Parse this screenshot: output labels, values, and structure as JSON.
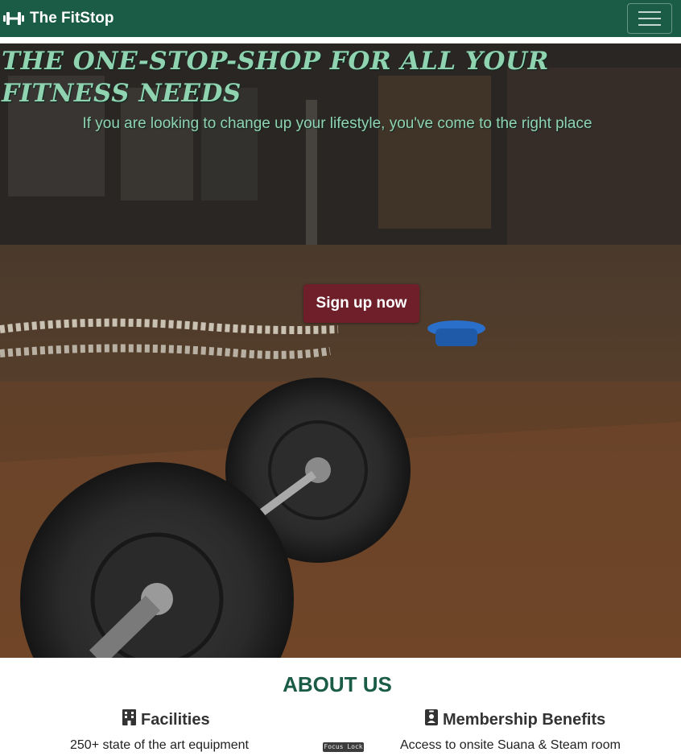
{
  "navbar": {
    "brand_icon": "dumbbell-icon",
    "brand_name": "The FitStop",
    "toggler_icon": "hamburger-icon"
  },
  "hero": {
    "title": "THE ONE-STOP-SHOP FOR ALL YOUR FITNESS NEEDS",
    "subtitle": "If you are looking to change up your lifestyle, you've come to the right place",
    "cta_label": "Sign up now",
    "background": "gym-floor-barbell-photo"
  },
  "about": {
    "title": "ABOUT US",
    "columns": [
      {
        "icon": "building-icon",
        "heading": "Facilities",
        "text": "250+ state of the art equipment"
      },
      {
        "icon": "id-badge-icon",
        "heading": "Membership Benefits",
        "text": "Access to onsite Suana & Steam room"
      }
    ]
  },
  "overlay": {
    "focus_lock_label": "Focus Lock"
  },
  "colors": {
    "navbar_bg": "#1a5c46",
    "accent_text": "#8fd3b1",
    "cta_bg": "#6e1f2a",
    "about_title": "#1a5c46"
  }
}
